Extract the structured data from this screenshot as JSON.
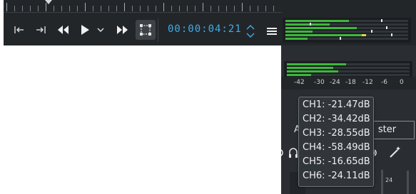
{
  "transport": {
    "timecode": "00:00:04:21",
    "buttons": [
      {
        "name": "go-to-start-icon"
      },
      {
        "name": "go-to-end-icon"
      },
      {
        "name": "rewind-icon"
      },
      {
        "name": "play-icon"
      },
      {
        "name": "play-options-chevron-icon"
      },
      {
        "name": "fast-forward-icon"
      },
      {
        "name": "zone-selection-icon"
      }
    ],
    "menu_icon": "hamburger-menu-icon"
  },
  "top_meter": {
    "levels": [
      0.52,
      0.36,
      0.58,
      0.22,
      0.62,
      0.18
    ],
    "peaks": [
      0.78,
      0.2,
      0.82,
      0.7,
      0.86,
      0.44
    ],
    "colors": {
      "green": "#3fb63f",
      "yellow": "#e8d14a",
      "bg": "#31363b"
    }
  },
  "mixer": {
    "scale_labels": [
      "-42",
      "-30",
      "-24",
      "-18",
      "-12",
      "-6",
      "0"
    ],
    "levels": [
      0.48,
      0.38,
      0.42,
      0.2
    ],
    "tab_partial": "A",
    "tab_master": "ster",
    "volume_value": "24"
  },
  "tooltip": {
    "lines": [
      "CH1: -21.47dB",
      "CH2: -34.42dB",
      "CH3: -28.55dB",
      "CH4: -58.49dB",
      "CH5: -16.65dB",
      "CH6: -24.11dB"
    ]
  },
  "colors": {
    "accent": "#3daee9",
    "dark_bg": "#232629"
  }
}
